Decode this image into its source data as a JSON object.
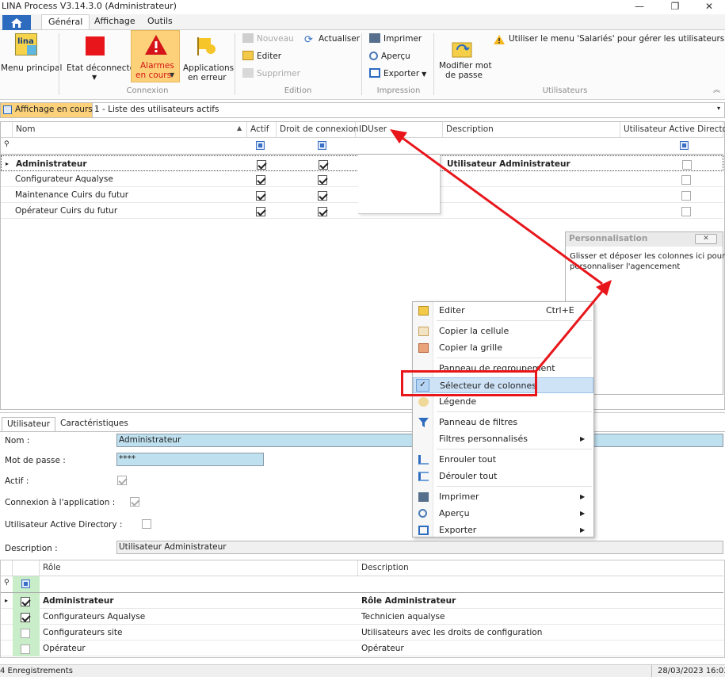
{
  "window": {
    "title": "LINA Process  V3.14.3.0  (Administrateur)",
    "minimize": "—",
    "maximize": "❐",
    "close": "✕"
  },
  "tabs": [
    {
      "label": "Général"
    },
    {
      "label": "Affichage"
    },
    {
      "label": "Outils"
    }
  ],
  "ribbon": {
    "menu_principal": "Menu principal",
    "logo_text": "lina",
    "etat": "Etat déconnecté",
    "alarmes_1": "Alarmes",
    "alarmes_2": "en cours",
    "applications_1": "Applications",
    "applications_2": "en erreur",
    "group_connexion": "Connexion",
    "nouveau": "Nouveau",
    "actualiser": "Actualiser",
    "editer": "Editer",
    "supprimer": "Supprimer",
    "group_edition": "Edition",
    "imprimer": "Imprimer",
    "apercu": "Aperçu",
    "exporter": "Exporter",
    "group_impression": "Impression",
    "modifier_1": "Modifier mot",
    "modifier_2": "de passe",
    "info": "Utiliser le menu 'Salariés' pour gérer les utilisateurs",
    "group_utilisateurs": "Utilisateurs"
  },
  "filter": {
    "label": "Affichage en cours :",
    "value": "1 - Liste des utilisateurs actifs"
  },
  "grid": {
    "columns": [
      "Nom",
      "Actif",
      "Droit de connexion",
      "IDUser",
      "Description",
      "Utilisateur Active Directory"
    ],
    "rows": [
      {
        "nom": "Administrateur",
        "actif": true,
        "droit": true,
        "description": "Utilisateur Administrateur",
        "ad": false
      },
      {
        "nom": "Configurateur Aqualyse",
        "actif": true,
        "droit": true,
        "description": "",
        "ad": false
      },
      {
        "nom": "Maintenance Cuirs du futur",
        "actif": true,
        "droit": true,
        "description": "",
        "ad": false
      },
      {
        "nom": "Opérateur Cuirs du futur",
        "actif": true,
        "droit": true,
        "description": "",
        "ad": false
      }
    ]
  },
  "perso": {
    "title": "Personnalisation",
    "close": "✕",
    "text_1": "Glisser et déposer les colonnes ici pour",
    "text_2": "personnaliser l'agencement"
  },
  "context_menu": [
    {
      "label": "Editer",
      "shortcut": "Ctrl+E"
    },
    {
      "label": "Copier la cellule"
    },
    {
      "label": "Copier la grille"
    },
    {
      "label": "Panneau de regroupement"
    },
    {
      "label": "Sélecteur de colonnes",
      "checked": true
    },
    {
      "label": "Légende"
    },
    {
      "label": "Panneau de filtres"
    },
    {
      "label": "Filtres personnalisés",
      "submenu": true
    },
    {
      "label": "Enrouler tout"
    },
    {
      "label": "Dérouler tout"
    },
    {
      "label": "Imprimer",
      "submenu": true
    },
    {
      "label": "Aperçu",
      "submenu": true
    },
    {
      "label": "Exporter",
      "submenu": true
    }
  ],
  "detail_tabs": [
    {
      "label": "Utilisateur"
    },
    {
      "label": "Caractéristiques"
    }
  ],
  "form": {
    "nom_label": "Nom :",
    "nom_value": "Administrateur",
    "mdp_label": "Mot de passe :",
    "mdp_value": "****",
    "actif_label": "Actif :",
    "connexion_label": "Connexion à l'application :",
    "ad_label": "Utilisateur Active Directory :",
    "desc_label": "Description :",
    "desc_value": "Utilisateur Administrateur"
  },
  "roles": {
    "columns": [
      "Rôle",
      "Description"
    ],
    "rows": [
      {
        "checked": true,
        "role": "Administrateur",
        "description": "Rôle Administrateur"
      },
      {
        "checked": true,
        "role": "Configurateurs Aqualyse",
        "description": "Technicien aqualyse"
      },
      {
        "checked": false,
        "role": "Configurateurs site",
        "description": "Utilisateurs avec les droits de configuration"
      },
      {
        "checked": false,
        "role": "Opérateur",
        "description": "Opérateur"
      }
    ]
  },
  "status": {
    "left": "4 Enregistrements",
    "right": "28/03/2023 16:03"
  },
  "colors": {
    "accent": "#e8161b",
    "selected_bg": "#bfe0ee",
    "ribbon_active": "#fcd17a"
  }
}
